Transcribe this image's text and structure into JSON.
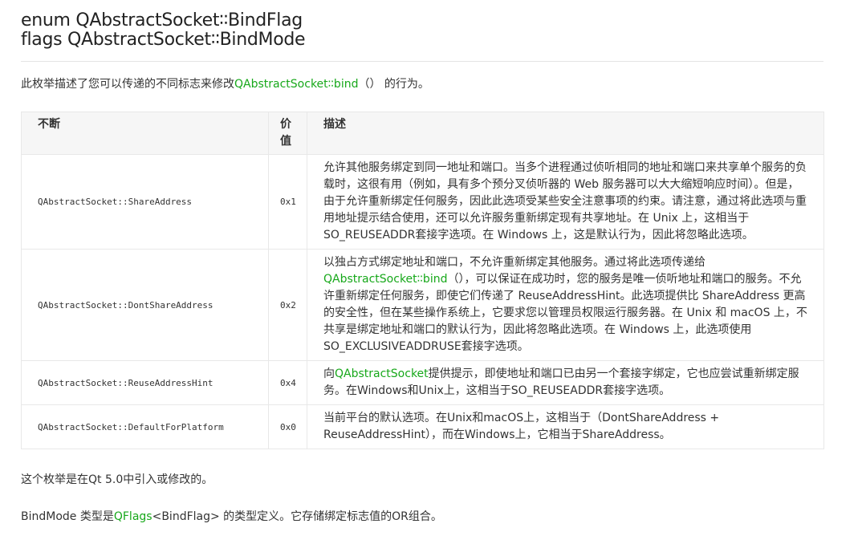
{
  "heading": {
    "line1": "enum QAbstractSocket∶∶BindFlag",
    "line2": "flags QAbstractSocket∶∶BindMode"
  },
  "intro": {
    "before": "此枚举描述了您可以传递的不同标志来修改",
    "link": "QAbstractSocket∶∶bind",
    "after": "（） 的行为。"
  },
  "table": {
    "headers": [
      "不断",
      "价值",
      "描述"
    ],
    "rows": [
      {
        "constant": "QAbstractSocket::ShareAddress",
        "value": "0x1",
        "desc": "允许其他服务绑定到同一地址和端口。当多个进程通过侦听相同的地址和端口来共享单个服务的负载时，这很有用（例如，具有多个预分叉侦听器的 Web 服务器可以大大缩短响应时间）。但是，由于允许重新绑定任何服务，因此此选项受某些安全注意事项的约束。请注意，通过将此选项与重用地址提示结合使用，还可以允许服务重新绑定现有共享地址。在 Unix 上，这相当于SO_REUSEADDR套接字选项。在 Windows 上，这是默认行为，因此将忽略此选项。"
      },
      {
        "constant": "QAbstractSocket::DontShareAddress",
        "value": "0x2",
        "desc_before": "以独占方式绑定地址和端口，不允许重新绑定其他服务。通过将此选项传递给",
        "desc_link": "QAbstractSocket∶∶bind",
        "desc_after": "（），可以保证在成功时，您的服务是唯一侦听地址和端口的服务。不允许重新绑定任何服务，即使它们传递了 ReuseAddressHint。此选项提供比 ShareAddress 更高的安全性，但在某些操作系统上，它要求您以管理员权限运行服务器。在 Unix 和 macOS 上，不共享是绑定地址和端口的默认行为，因此将忽略此选项。在 Windows 上，此选项使用SO_EXCLUSIVEADDRUSE套接字选项。"
      },
      {
        "constant": "QAbstractSocket::ReuseAddressHint",
        "value": "0x4",
        "desc_before": "向",
        "desc_link": "QAbstractSocket",
        "desc_after": "提供提示，即使地址和端口已由另一个套接字绑定，它也应尝试重新绑定服务。在Windows和Unix上，这相当于SO_REUSEADDR套接字选项。"
      },
      {
        "constant": "QAbstractSocket::DefaultForPlatform",
        "value": "0x0",
        "desc": "当前平台的默认选项。在Unix和macOS上，这相当于（DontShareAddress + ReuseAddressHint），而在Windows上，它相当于ShareAddress。"
      }
    ]
  },
  "note": "这个枚举是在Qt 5.0中引入或修改的。",
  "bindmode": {
    "before": "BindMode 类型是",
    "link": "QFlags",
    "after": "<BindFlag> 的类型定义。它存储绑定标志值的OR组合。"
  },
  "colors": {
    "link": "#17a81a",
    "text": "#333333",
    "header_bg": "#f6f6f6",
    "border": "#e8e8e8"
  }
}
